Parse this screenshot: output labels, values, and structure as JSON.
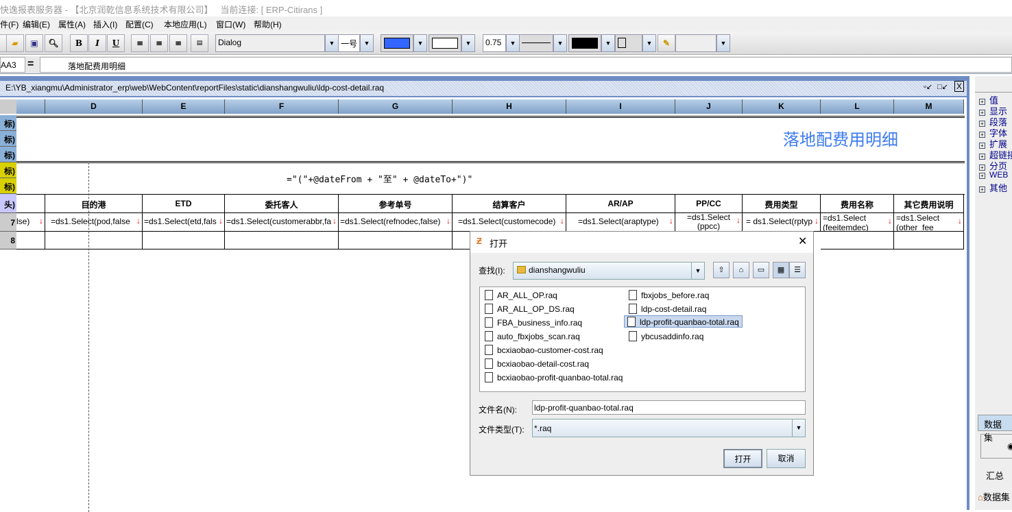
{
  "window": {
    "title": "快逸报表服务器 - 【北京润乾信息系统技术有限公司】   当前连接: [ ERP-Citirans ]"
  },
  "menu": [
    "件(F)",
    "编辑(E)",
    "属性(A)",
    "插入(I)",
    "配置(C)",
    "本地应用(L)",
    "窗口(W)",
    "帮助(H)"
  ],
  "toolbar": {
    "bold": "B",
    "italic": "I",
    "underline": "U",
    "font": "Dialog",
    "font_size": "一号",
    "fore_color": "#3366ff",
    "back_color": "#ffffff",
    "line_width": "0.75",
    "border_color": "#000000"
  },
  "formula_bar": {
    "cell_ref": "AA3",
    "eq": "=",
    "value": "落地配费用明细"
  },
  "document": {
    "path": "E:\\YB_xiangmu\\Administrator_erp\\web\\WebContent\\reportFiles\\static\\dianshangwuliu\\ldp-cost-detail.raq"
  },
  "sheet": {
    "columns": [
      "D",
      "E",
      "F",
      "G",
      "H",
      "I",
      "J",
      "K",
      "L",
      "M"
    ],
    "row_headers": [
      "标)",
      "标)",
      "标)",
      "标)",
      "标)",
      "头)",
      "7",
      "8"
    ],
    "title": "落地配费用明细",
    "date_formula": "=\"(\"+@dateFrom  + \"至\" + @dateTo+\")\"",
    "headers": [
      "目的港",
      "ETD",
      "委托客人",
      "参考单号",
      "结算客户",
      "AR/AP",
      "PP/CC",
      "费用类型",
      "费用名称",
      "其它费用说明"
    ],
    "row7_c": "lse)",
    "row7": [
      "=ds1.Select(pod,false",
      "=ds1.Select(etd,fals",
      "=ds1.Select(customerabbr,fa",
      "=ds1.Select(refnodec,false)",
      "=ds1.Select(customecode)",
      "=ds1.Select(araptype)",
      "=ds1.Select (ppcc)",
      "= ds1.Select(rptyp",
      "=ds1.Select (feeitemdec)",
      "=ds1.Select (other_fee_"
    ]
  },
  "right_panel": {
    "tree": [
      "值",
      "显示",
      "段落",
      "字体",
      "扩展",
      "超链接",
      "分页",
      "WEB",
      "其他"
    ],
    "tab": "数据集",
    "summary": "汇总",
    "dataset_node": "数据集"
  },
  "dialog": {
    "title": "打开",
    "look_in_label": "查找(I):",
    "look_in": "dianshangwuliu",
    "files": [
      "AR_ALL_OP.raq",
      "AR_ALL_OP_DS.raq",
      "FBA_business_info.raq",
      "auto_fbxjobs_scan.raq",
      "bcxiaobao-customer-cost.raq",
      "bcxiaobao-detail-cost.raq",
      "bcxiaobao-profit-quanbao-total.raq",
      "fbxjobs_before.raq",
      "ldp-cost-detail.raq",
      "ldp-profit-quanbao-total.raq",
      "ybcusaddinfo.raq"
    ],
    "selected": "ldp-profit-quanbao-total.raq",
    "filename_label": "文件名(N):",
    "filename": "ldp-profit-quanbao-total.raq",
    "filetype_label": "文件类型(T):",
    "filetype": "*.raq",
    "open": "打开",
    "cancel": "取消"
  }
}
